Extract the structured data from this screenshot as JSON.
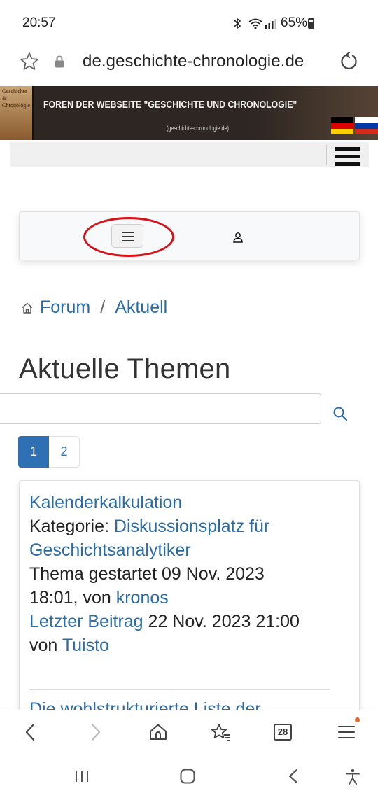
{
  "status_bar": {
    "time": "20:57",
    "battery": "65%",
    "icons": [
      "bluetooth-icon",
      "wifi-icon",
      "signal-icon",
      "battery-icon"
    ]
  },
  "browser": {
    "url": "de.geschichte-chronologie.de",
    "tab_count": "28"
  },
  "banner": {
    "title": "FOREN DER WEBSEITE \"GESCHICHTE UND CHRONOLOGIE\"",
    "subtitle": "(geschichte-chronologie.de)",
    "logo_text": "Geschichte & Chronologie"
  },
  "breadcrumb": {
    "home": "Forum",
    "separator": "/",
    "current": "Aktuell"
  },
  "page": {
    "title": "Aktuelle Themen",
    "search_placeholder": ""
  },
  "pagination": {
    "pages": [
      "1",
      "2"
    ],
    "active": "1"
  },
  "topics": [
    {
      "title": "Kalenderkalkulation",
      "category_label": "Kategorie:",
      "category": "Diskussionsplatz für Geschichtsanalytiker",
      "started_label": "Thema gestartet 09 Nov. 2023 18:01, von",
      "started_by": "kronos",
      "last_post_label": "Letzter Beitrag",
      "last_post_date": "22 Nov. 2023 21:00",
      "by_label": "von",
      "last_post_by": "Tuisto"
    },
    {
      "title": "Die wohlstrukturierte Liste der"
    }
  ],
  "colors": {
    "link": "#2c6ca6",
    "active_page": "#2f6fb3",
    "highlight_ellipse": "#d4141a"
  }
}
